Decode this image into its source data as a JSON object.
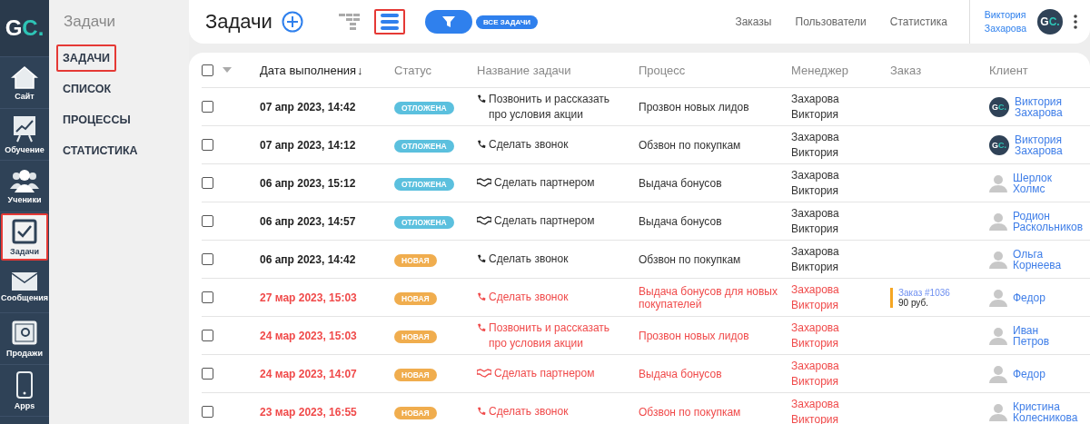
{
  "logo": {
    "first": "G",
    "second": "C."
  },
  "rail": [
    {
      "label": "Сайт",
      "kind": "house",
      "selected": false
    },
    {
      "label": "Обучение",
      "kind": "chart",
      "selected": false
    },
    {
      "label": "Ученики",
      "kind": "people",
      "selected": false
    },
    {
      "label": "Задачи",
      "kind": "task",
      "selected": true
    },
    {
      "label": "Сообщения",
      "kind": "mail",
      "selected": false
    },
    {
      "label": "Продажи",
      "kind": "safe",
      "selected": false
    },
    {
      "label": "Apps",
      "kind": "phone",
      "selected": false
    }
  ],
  "sidebar": {
    "title": "Задачи",
    "items": [
      {
        "label": "ЗАДАЧИ",
        "selected": true
      },
      {
        "label": "СПИСОК",
        "selected": false
      },
      {
        "label": "ПРОЦЕССЫ",
        "selected": false
      },
      {
        "label": "СТАТИСТИКА",
        "selected": false
      }
    ]
  },
  "header": {
    "title": "Задачи",
    "views": [
      {
        "kind": "tree",
        "selected": false
      },
      {
        "kind": "list",
        "selected": true
      }
    ],
    "filter_badge": "ВСЕ ЗАДАЧИ",
    "nav": [
      "Заказы",
      "Пользователи",
      "Статистика"
    ],
    "user": {
      "first": "Виктория",
      "last": "Захарова",
      "avatar": {
        "first": "G",
        "second": "C."
      }
    }
  },
  "table": {
    "columns": [
      "Дата выполнения",
      "Статус",
      "Название задачи",
      "Процесс",
      "Менеджер",
      "Заказ",
      "Клиент"
    ],
    "sort_arrow": "↓",
    "select_all_checked": false,
    "rows": [
      {
        "checked": false,
        "overdue": false,
        "date": "07 апр 2023, 14:42",
        "status": {
          "kind": "postponed",
          "label": "ОТЛОЖЕНА"
        },
        "task": {
          "kind": "call",
          "text": "Позвонить и рассказать про условия акции"
        },
        "process": "Прозвон новых лидов",
        "manager": [
          "Захарова",
          "Виктория"
        ],
        "client": {
          "kind": "logo",
          "avatar": {
            "first": "G",
            "second": "C."
          },
          "first": "Виктория",
          "last": "Захарова"
        }
      },
      {
        "checked": false,
        "overdue": false,
        "date": "07 апр 2023, 14:12",
        "status": {
          "kind": "postponed",
          "label": "ОТЛОЖЕНА"
        },
        "task": {
          "kind": "call",
          "text": "Сделать звонок"
        },
        "process": "Обзвон по покупкам",
        "manager": [
          "Захарова",
          "Виктория"
        ],
        "client": {
          "kind": "logo",
          "avatar": {
            "first": "G",
            "second": "C."
          },
          "first": "Виктория",
          "last": "Захарова"
        }
      },
      {
        "checked": false,
        "overdue": false,
        "date": "06 апр 2023, 15:12",
        "status": {
          "kind": "postponed",
          "label": "ОТЛОЖЕНА"
        },
        "task": {
          "kind": "partner",
          "text": "Сделать партнером"
        },
        "process": "Выдача бонусов",
        "manager": [
          "Захарова",
          "Виктория"
        ],
        "client": {
          "kind": "person",
          "first": "Шерлок",
          "last": "Холмс"
        }
      },
      {
        "checked": false,
        "overdue": false,
        "date": "06 апр 2023, 14:57",
        "status": {
          "kind": "postponed",
          "label": "ОТЛОЖЕНА"
        },
        "task": {
          "kind": "partner",
          "text": "Сделать партнером"
        },
        "process": "Выдача бонусов",
        "manager": [
          "Захарова",
          "Виктория"
        ],
        "client": {
          "kind": "person",
          "first": "Родион",
          "last": "Раскольников"
        }
      },
      {
        "checked": false,
        "overdue": false,
        "date": "06 апр 2023, 14:42",
        "status": {
          "kind": "new",
          "label": "НОВАЯ"
        },
        "task": {
          "kind": "call",
          "text": "Сделать звонок"
        },
        "process": "Обзвон по покупкам",
        "manager": [
          "Захарова",
          "Виктория"
        ],
        "client": {
          "kind": "person",
          "first": "Ольга",
          "last": "Корнеева"
        }
      },
      {
        "checked": false,
        "overdue": true,
        "date": "27 мар 2023, 15:03",
        "status": {
          "kind": "new",
          "label": "НОВАЯ"
        },
        "task": {
          "kind": "call",
          "text": "Сделать звонок"
        },
        "process": "Выдача бонусов для новых покупателей",
        "manager": [
          "Захарова",
          "Виктория"
        ],
        "order": {
          "link": "Заказ #1036",
          "sum": "90 руб."
        },
        "client": {
          "kind": "person",
          "first": "Федор"
        }
      },
      {
        "checked": false,
        "overdue": true,
        "date": "24 мар 2023, 15:03",
        "status": {
          "kind": "new",
          "label": "НОВАЯ"
        },
        "task": {
          "kind": "call",
          "text": "Позвонить и рассказать про условия акции"
        },
        "process": "Прозвон новых лидов",
        "manager": [
          "Захарова",
          "Виктория"
        ],
        "client": {
          "kind": "person",
          "first": "Иван",
          "last": "Петров"
        }
      },
      {
        "checked": false,
        "overdue": true,
        "date": "24 мар 2023, 14:07",
        "status": {
          "kind": "new",
          "label": "НОВАЯ"
        },
        "task": {
          "kind": "partner",
          "text": "Сделать партнером"
        },
        "process": "Выдача бонусов",
        "manager": [
          "Захарова",
          "Виктория"
        ],
        "client": {
          "kind": "person",
          "first": "Федор"
        }
      },
      {
        "checked": false,
        "overdue": true,
        "date": "23 мар 2023, 16:55",
        "status": {
          "kind": "new",
          "label": "НОВАЯ"
        },
        "task": {
          "kind": "call",
          "text": "Сделать звонок"
        },
        "process": "Обзвон по покупкам",
        "manager": [
          "Захарова",
          "Виктория"
        ],
        "client": {
          "kind": "person",
          "first": "Кристина",
          "last": "Колесникова"
        }
      }
    ]
  }
}
